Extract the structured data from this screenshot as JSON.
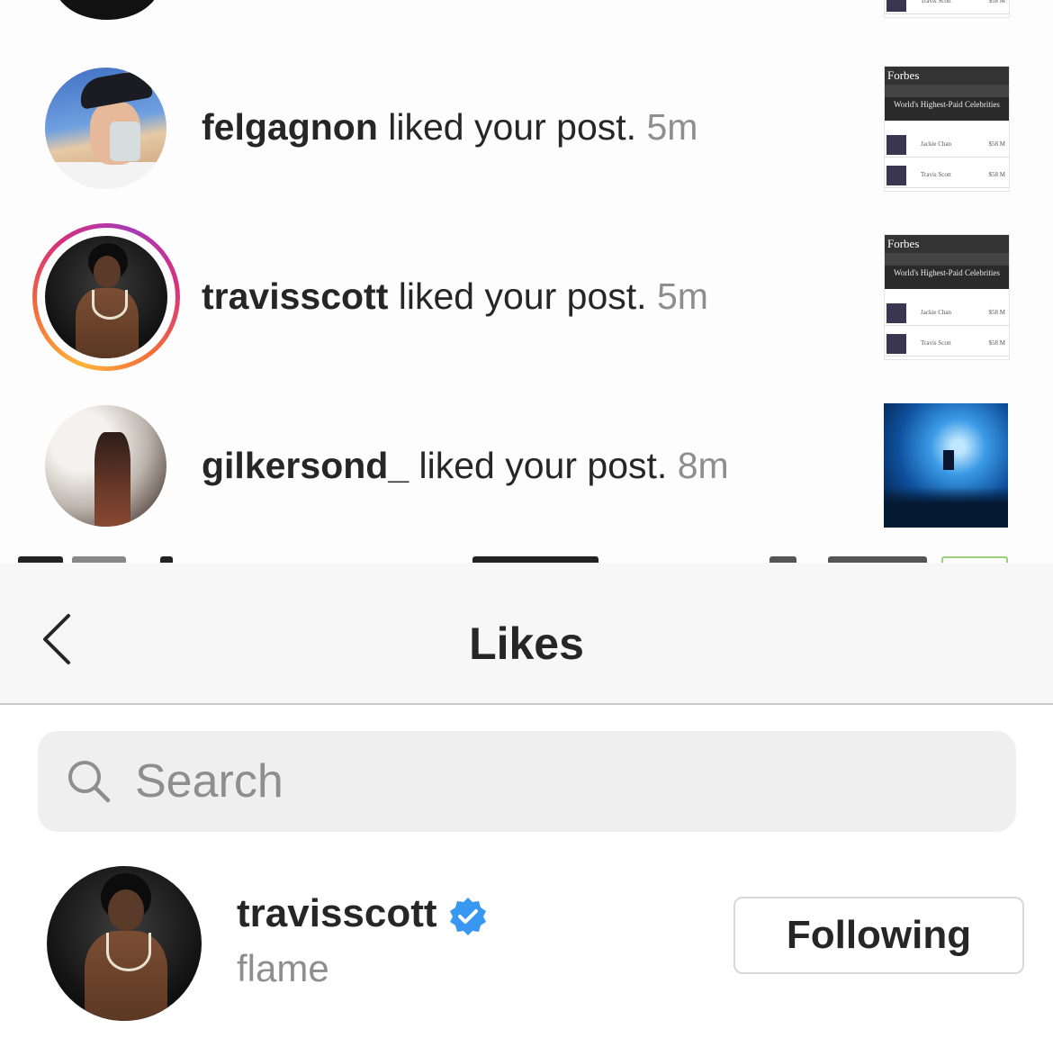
{
  "activity": {
    "items": [
      {
        "username": "felgagnon",
        "action": "liked your post.",
        "time": "5m",
        "post_thumbnail": "forbes-highest-paid-list"
      },
      {
        "username": "travisscott",
        "action": "liked your post.",
        "time": "5m",
        "post_thumbnail": "forbes-highest-paid-list",
        "has_story_ring": true
      },
      {
        "username": "gilkersond_",
        "action": "liked your post.",
        "time": "8m",
        "post_thumbnail": "concert-photo"
      }
    ],
    "thumbnail_text": {
      "brand": "Forbes",
      "headline": "World's Highest-Paid Celebrities",
      "rows": [
        {
          "name": "Jackie Chan",
          "amount": "$58 M"
        },
        {
          "name": "Travis Scott",
          "amount": "$58 M"
        }
      ]
    }
  },
  "likes_screen": {
    "title": "Likes",
    "back_icon": "chevron-left-icon",
    "search": {
      "placeholder": "Search",
      "value": "",
      "icon": "search-icon"
    },
    "likers": [
      {
        "username": "travisscott",
        "subtitle": "flame",
        "verified": true,
        "button_label": "Following"
      }
    ]
  },
  "colors": {
    "verified_badge": "#3897f0",
    "story_ring": [
      "#fdb33a",
      "#f36b3a",
      "#d62f7e",
      "#a73ab6"
    ],
    "secondary_text": "#8e8e8e"
  }
}
